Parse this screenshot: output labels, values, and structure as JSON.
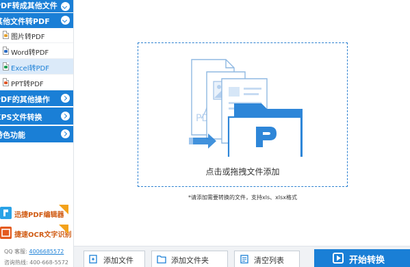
{
  "sidebar": {
    "categories": [
      {
        "label": "PDF转成其他文件",
        "expanded": true
      },
      {
        "label": "其他文件转PDF",
        "expanded": true
      },
      {
        "label": "PDF的其他操作",
        "expanded": false
      },
      {
        "label": "XPS文件转换",
        "expanded": false
      },
      {
        "label": "特色功能",
        "expanded": false
      }
    ],
    "items": [
      {
        "label": "图片转PDF",
        "icon": "image-file-icon",
        "color": "#e3a12f"
      },
      {
        "label": "Word转PDF",
        "icon": "word-file-icon",
        "color": "#2b6cc4"
      },
      {
        "label": "Excel转PDF",
        "icon": "excel-file-icon",
        "color": "#1e9e52"
      },
      {
        "label": "PPT转PDF",
        "icon": "ppt-file-icon",
        "color": "#e0582a"
      }
    ],
    "promos": [
      {
        "label": "迅捷PDF编辑器",
        "icon": "pdf-editor-icon",
        "color": "#2aa2e6"
      },
      {
        "label": "捷速OCR文字识别",
        "icon": "ocr-icon",
        "color": "#e45a1e"
      }
    ],
    "contact": {
      "qq_label": "QQ 客服:",
      "qq_value": "4006685572",
      "phone_label": "咨询热线:",
      "phone_value": "400-668-5572"
    }
  },
  "main": {
    "drop_label": "点击或拖拽文件添加",
    "hint": "*请添加需要转换的文件，支持xls、xlsx格式"
  },
  "toolbar": {
    "add_file": "添加文件",
    "add_folder": "添加文件夹",
    "clear_list": "清空列表",
    "start": "开始转换"
  },
  "colors": {
    "accent": "#1a7fd6",
    "active_bg": "#dbeaf9",
    "promo_text": "#d05a12"
  }
}
